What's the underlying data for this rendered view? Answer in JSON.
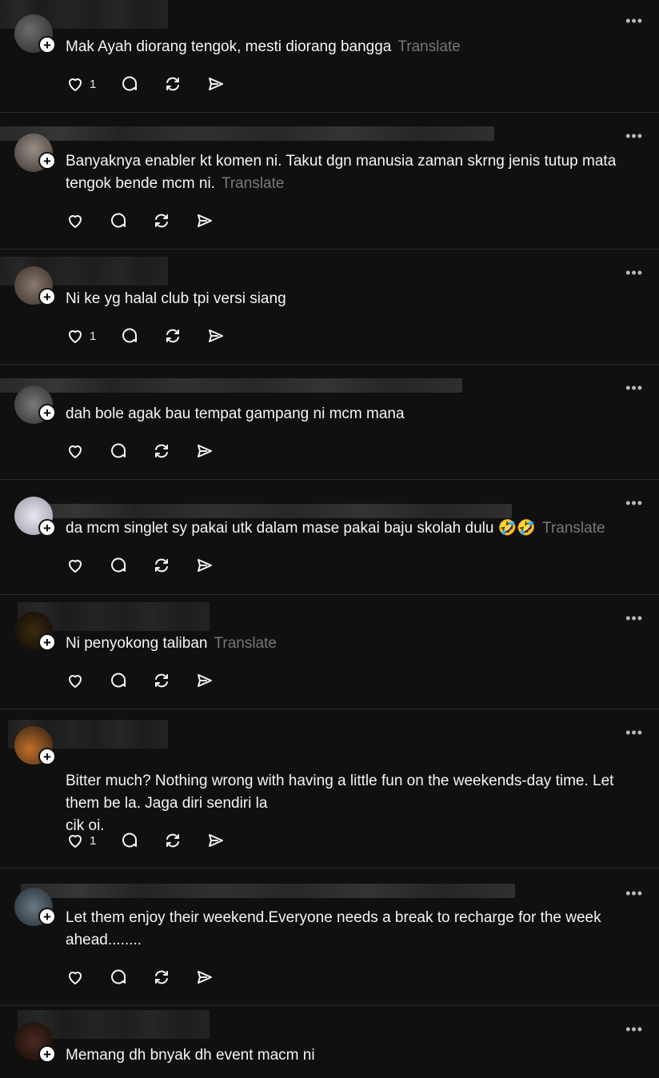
{
  "ui": {
    "translate_label": "Translate",
    "more_label": "•••"
  },
  "posts": [
    {
      "text": "Mak Ayah diorang tengok, mesti diorang bangga",
      "translate": true,
      "likes": "1"
    },
    {
      "text": "Banyaknya enabler kt komen ni. Takut dgn manusia zaman skrng jenis tutup mata tengok bende mcm ni.",
      "translate": true,
      "likes": ""
    },
    {
      "text": "Ni ke yg halal club tpi versi siang",
      "translate": false,
      "likes": "1"
    },
    {
      "text": "dah bole agak bau tempat gampang ni mcm mana",
      "translate": false,
      "likes": ""
    },
    {
      "text": "da mcm singlet sy pakai utk dalam mase pakai baju skolah dulu 🤣🤣",
      "translate": true,
      "likes": ""
    },
    {
      "text": "Ni penyokong taliban",
      "translate": true,
      "likes": ""
    },
    {
      "text": "Bitter much? Nothing wrong with having a little fun on the weekends-day time. Let them be la. Jaga diri sendiri la\ncik oi.",
      "translate": false,
      "likes": "1"
    },
    {
      "text": "Let them enjoy their weekend.Everyone needs a break to recharge for the week ahead........",
      "translate": false,
      "likes": ""
    },
    {
      "text": "Memang dh bnyak dh event macm ni",
      "translate": false,
      "likes": ""
    }
  ]
}
